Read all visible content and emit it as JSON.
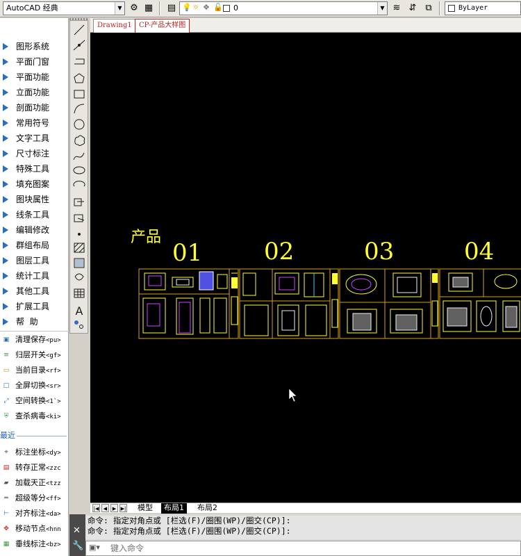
{
  "toolbar": {
    "workspace": "AutoCAD 经典",
    "layer_name": "0",
    "color_value": "ByLayer"
  },
  "menu": {
    "items": [
      "图形系统",
      "平面门窗",
      "平面功能",
      "立面功能",
      "剖面功能",
      "常用符号",
      "文字工具",
      "尺寸标注",
      "特殊工具",
      "填充图案",
      "图块属性",
      "线条工具",
      "编辑修改",
      "群组布局",
      "图层工具",
      "统计工具",
      "其他工具",
      "扩展工具"
    ],
    "help_label": "帮  助"
  },
  "quick": {
    "items": [
      {
        "label": "清理保存",
        "shortcut": "<pu>",
        "icon": "save-icon"
      },
      {
        "label": "归层开关",
        "shortcut": "<gf>",
        "icon": "layers-icon"
      },
      {
        "label": "当前目录",
        "shortcut": "<rf>",
        "icon": "folder-icon"
      },
      {
        "label": "全屏切换",
        "shortcut": "<sr>",
        "icon": "fullscreen-icon"
      },
      {
        "label": "空间转换",
        "shortcut": "<1`>",
        "icon": "space-icon"
      },
      {
        "label": "查杀病毒",
        "shortcut": "<ki>",
        "icon": "shield-icon"
      }
    ],
    "recent_label": "最近",
    "recent": [
      {
        "label": "标注坐标",
        "shortcut": "<dy>",
        "icon": "coord-icon"
      },
      {
        "label": "转存正常",
        "shortcut": "<zzc",
        "icon": "tch-icon"
      },
      {
        "label": "加载天正",
        "shortcut": "<tzz",
        "icon": "load-icon"
      },
      {
        "label": "超级等分",
        "shortcut": "<ff>",
        "icon": "divide-icon"
      },
      {
        "label": "对齐标注",
        "shortcut": "<da>",
        "icon": "align-dim-icon"
      },
      {
        "label": "移动节点",
        "shortcut": "<hnn",
        "icon": "move-node-icon"
      },
      {
        "label": "垂线标注",
        "shortcut": "<bz>",
        "icon": "grid-icon"
      }
    ]
  },
  "tabs": {
    "drawing1": "Drawing1",
    "active": "CP-产品大样图"
  },
  "drawing": {
    "heading": "产品",
    "numbers": [
      "01",
      "02",
      "03",
      "04"
    ]
  },
  "layout_tabs": [
    "模型",
    "布局1",
    "布局2"
  ],
  "command": {
    "history": [
      "命令: 指定对角点或 [栏选(F)/圈围(WP)/圈交(CP)]:",
      "命令: 指定对角点或 [栏选(F)/圈围(WP)/圈交(CP)]:"
    ],
    "placeholder": "键入命令"
  }
}
